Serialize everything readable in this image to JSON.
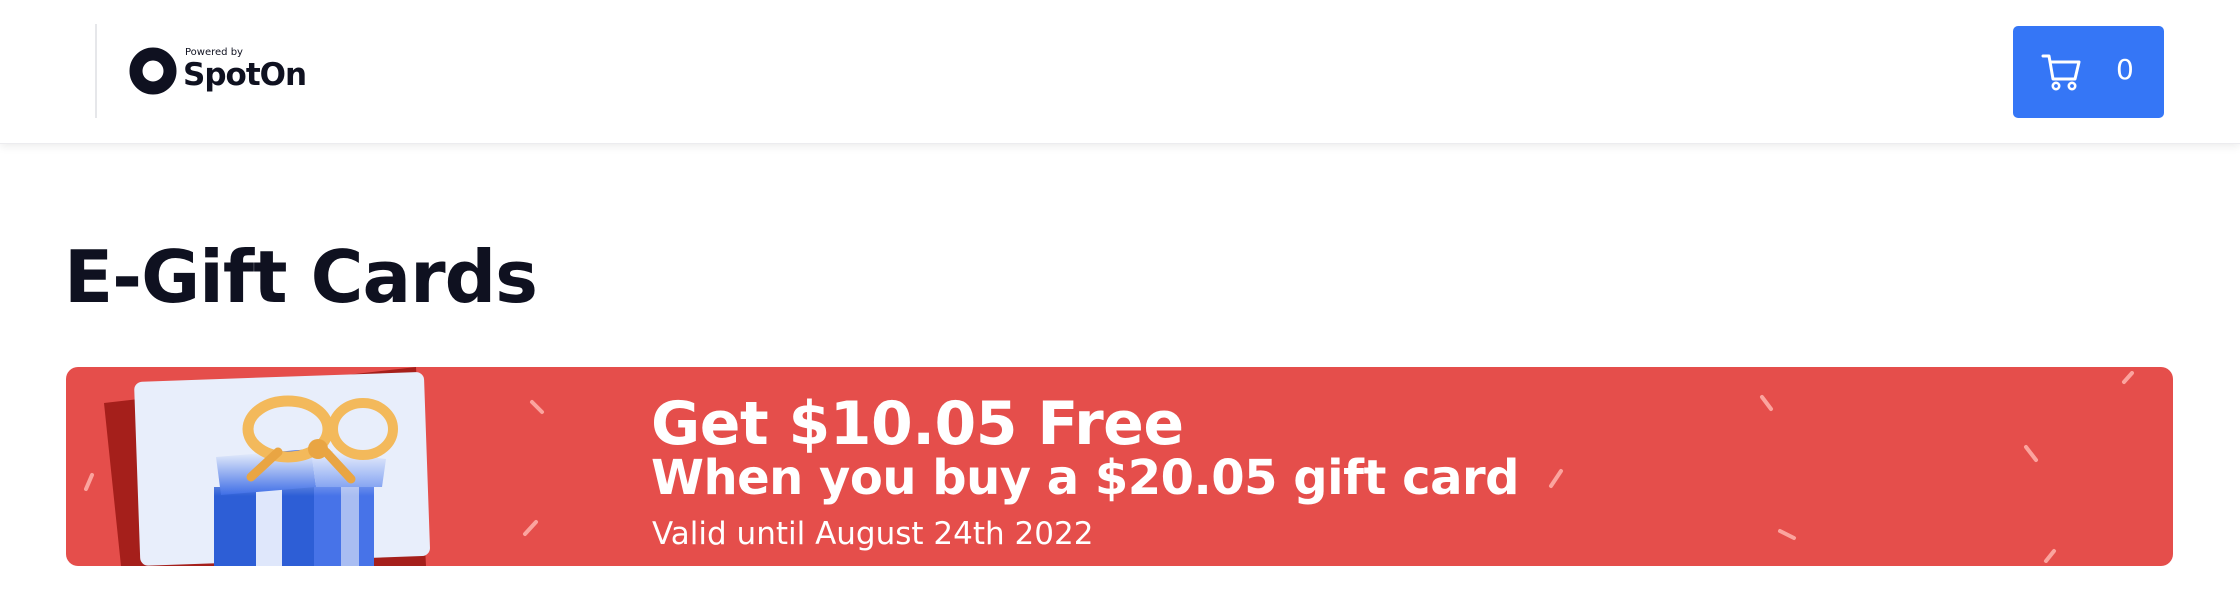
{
  "header": {
    "logo_small_text": "Powered by",
    "logo_name": "SpotOn",
    "cart": {
      "count": "0",
      "icon": "cart-icon"
    }
  },
  "page_title": "E-Gift Cards",
  "promo": {
    "headline": "Get $10.05 Free",
    "subheadline": "When you buy a $20.05 gift card",
    "validity": "Valid until August 24th 2022",
    "colors": {
      "banner": "#e54e4b",
      "card": "#e8eefb",
      "box": "#2d5ed6",
      "ribbon": "#f3b95b"
    }
  },
  "colors": {
    "accent": "#3576f6",
    "text": "#0f1120"
  }
}
